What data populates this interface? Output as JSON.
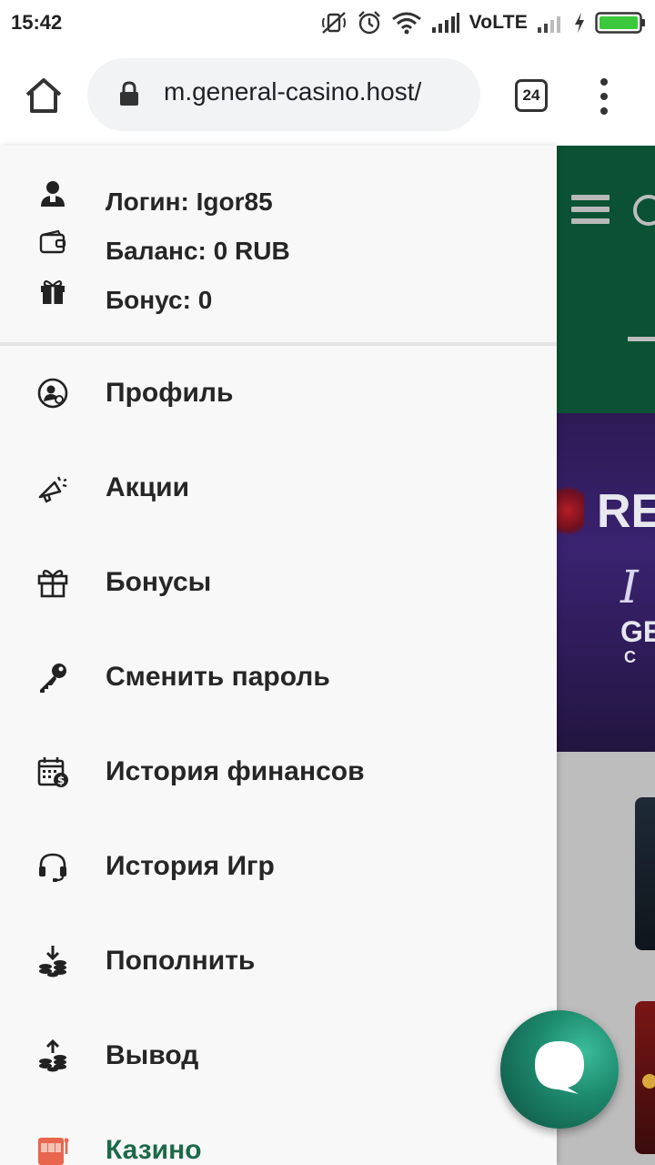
{
  "status_bar": {
    "time": "15:42",
    "network_label": "VoLTE",
    "icons": [
      "mute-icon",
      "alarm-icon",
      "wifi-icon",
      "signal-icon",
      "signal-weak-icon",
      "charging-icon",
      "battery-icon"
    ]
  },
  "browser": {
    "url": "m.general-casino.host/",
    "tab_count": "24",
    "icons": [
      "home-icon",
      "lock-icon",
      "more-icon"
    ]
  },
  "drawer": {
    "account": [
      {
        "icon": "user-icon",
        "label": "Логин: Igor85"
      },
      {
        "icon": "wallet-icon",
        "label": "Баланс: 0 RUB"
      },
      {
        "icon": "gift-icon",
        "label": "Бонус: 0"
      }
    ],
    "menu": [
      {
        "icon": "profile-icon",
        "label": "Профиль"
      },
      {
        "icon": "megaphone-icon",
        "label": "Акции"
      },
      {
        "icon": "gift-outline-icon",
        "label": "Бонусы"
      },
      {
        "icon": "key-icon",
        "label": "Сменить пароль"
      },
      {
        "icon": "calendar-money-icon",
        "label": "История финансов"
      },
      {
        "icon": "headset-icon",
        "label": "История Игр"
      },
      {
        "icon": "coins-deposit-icon",
        "label": "Пополнить"
      },
      {
        "icon": "coins-withdraw-icon",
        "label": "Вывод"
      },
      {
        "icon": "slot-machine-icon",
        "label": "Казино"
      }
    ]
  },
  "background_page": {
    "banner_text_1": "RE",
    "banner_text_2": "I",
    "banner_text_3": "GE",
    "banner_text_4": "C"
  },
  "colors": {
    "header_green": "#0b5234",
    "active_menu": "#1c6a48",
    "chat_button": "#1d8a6d",
    "drawer_bg": "#f8f8f8"
  }
}
